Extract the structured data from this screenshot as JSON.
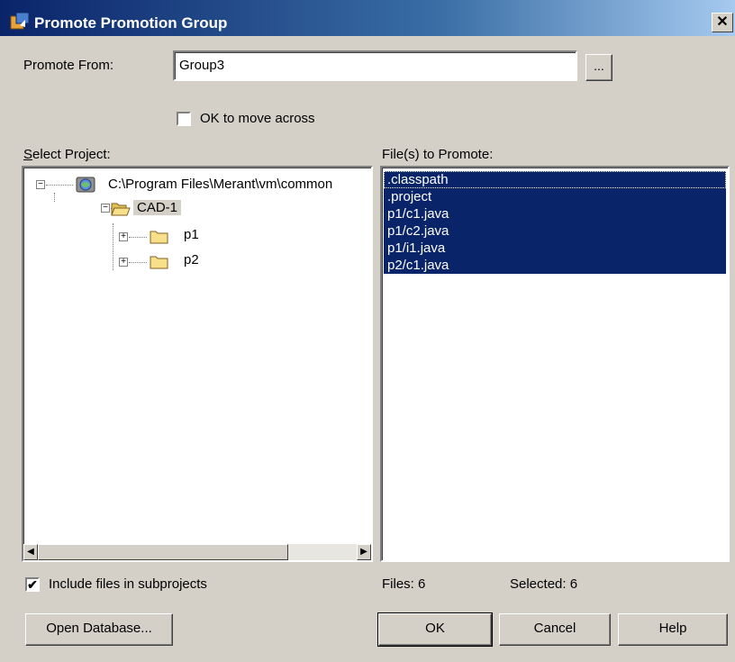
{
  "window": {
    "title": "Promote Promotion Group",
    "close_label": "✕"
  },
  "promote_from": {
    "label": "Promote From:",
    "value": "Group3",
    "browse_label": "..."
  },
  "ok_to_move": {
    "label": "OK to move across",
    "checked": false
  },
  "select_project": {
    "label": "Select Project:",
    "tree": [
      {
        "label": "C:\\Program Files\\Merant\\vm\\common",
        "icon": "globe-project-icon"
      },
      {
        "label": "CAD-1",
        "icon": "open-folder-icon",
        "selected": true
      },
      {
        "label": "p1",
        "icon": "folder-icon"
      },
      {
        "label": "p2",
        "icon": "folder-icon"
      }
    ]
  },
  "files_to_promote": {
    "label": "File(s) to Promote:",
    "items": [
      ".classpath",
      ".project",
      "p1/c1.java",
      "p1/c2.java",
      "p1/i1.java",
      "p2/c1.java"
    ]
  },
  "include_subprojects": {
    "label": "Include files in subprojects",
    "checked": true
  },
  "status": {
    "files": "Files: 6",
    "selected": "Selected: 6"
  },
  "buttons": {
    "open_database": "Open Database...",
    "ok": "OK",
    "cancel": "Cancel",
    "help": "Help"
  },
  "colors": {
    "title_bar": "#0a246a",
    "selection": "#0a246a",
    "dialog_bg": "#d4d0c8"
  }
}
